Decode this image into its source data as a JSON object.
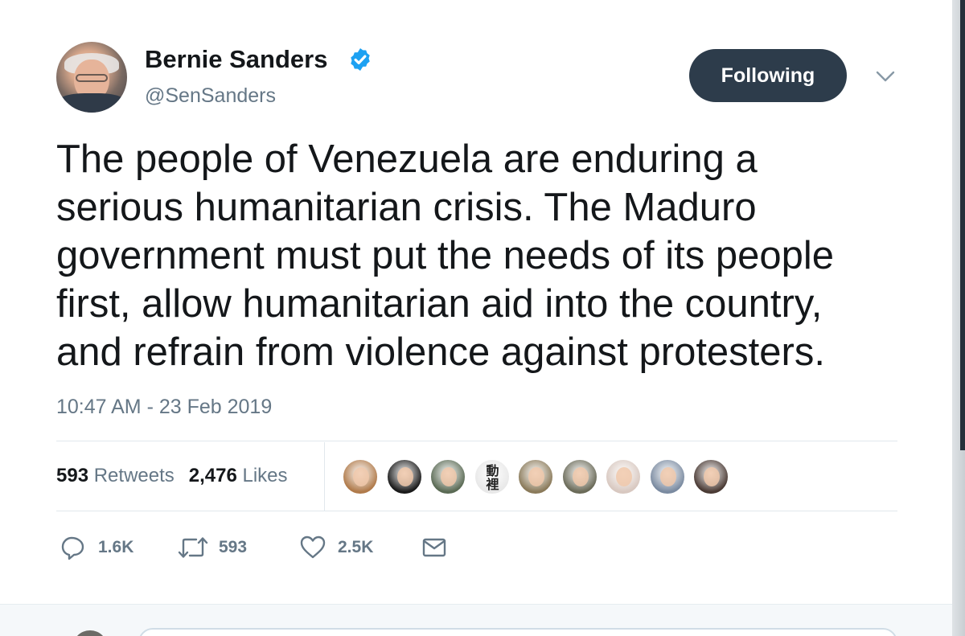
{
  "author": {
    "name": "Bernie Sanders",
    "handle": "@SenSanders",
    "verified": true,
    "avatar_icon": "profile-photo"
  },
  "follow_button": {
    "label": "Following"
  },
  "tweet": {
    "lines": [
      "The people of Venezuela are enduring a",
      "serious humanitarian crisis. The Maduro",
      "government must put the needs of its people",
      "first, allow humanitarian aid into the country,",
      "and refrain from violence against protesters."
    ],
    "timestamp": "10:47 AM - 23 Feb 2019"
  },
  "stats": {
    "retweets_count": "593",
    "retweets_label": "Retweets",
    "likes_count": "2,476",
    "likes_label": "Likes"
  },
  "likers": [
    {
      "name": "liker-avatar-1",
      "color": "#b07a4a"
    },
    {
      "name": "liker-avatar-2",
      "color": "#1a1a1a"
    },
    {
      "name": "liker-avatar-3",
      "color": "#5a6a54"
    },
    {
      "name": "liker-avatar-4",
      "color": "#e8e8e8",
      "glyph": "動\n裡"
    },
    {
      "name": "liker-avatar-5",
      "color": "#8a7a5a"
    },
    {
      "name": "liker-avatar-6",
      "color": "#6a6a58"
    },
    {
      "name": "liker-avatar-7",
      "color": "#d8c8c0"
    },
    {
      "name": "liker-avatar-8",
      "color": "#7a8aa0"
    },
    {
      "name": "liker-avatar-9",
      "color": "#4a3a34"
    }
  ],
  "actions": {
    "reply_count": "1.6K",
    "retweet_count": "593",
    "like_count": "2.5K"
  },
  "colors": {
    "text_primary": "#14171a",
    "text_secondary": "#657786",
    "verified_blue": "#1da1f2",
    "button_bg": "#2d3c4b",
    "divider": "#e1e8ed"
  }
}
